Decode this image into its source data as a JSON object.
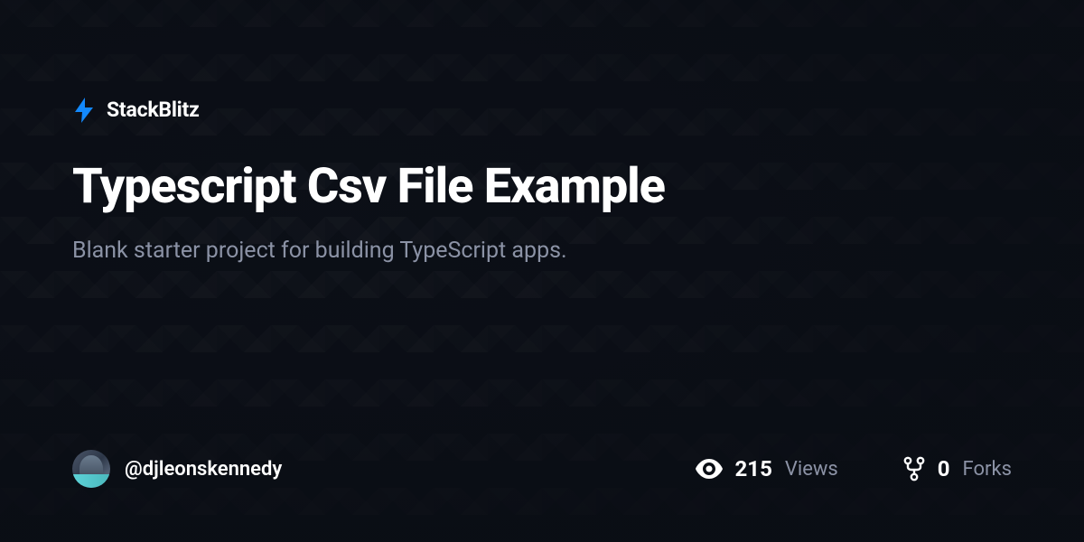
{
  "brand": {
    "name": "StackBlitz",
    "icon_color": "#1389fd"
  },
  "project": {
    "title": "Typescript Csv File Example",
    "description": "Blank starter project for building TypeScript apps."
  },
  "author": {
    "username": "@djleonskennedy"
  },
  "stats": {
    "views": {
      "value": "215",
      "label": "Views"
    },
    "forks": {
      "value": "0",
      "label": "Forks"
    }
  }
}
